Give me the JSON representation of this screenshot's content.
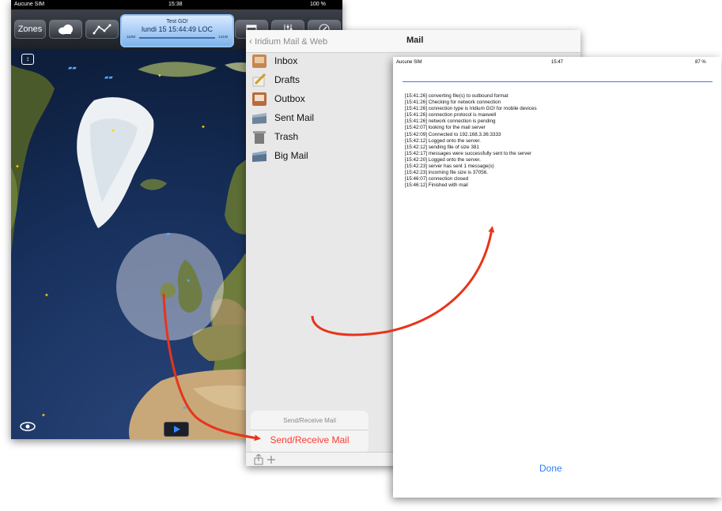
{
  "map_app": {
    "status_bar": {
      "carrier": "Aucune SIM",
      "time": "15:38",
      "battery": "100 %"
    },
    "toolbar": {
      "zones_label": "Zones",
      "center_title": "Test GO!",
      "center_time": "lundi 15 15:44:49 LOC",
      "scale_left": "110W",
      "scale_right": "141W"
    }
  },
  "mail_panel": {
    "back_label": "Iridium Mail & Web",
    "title": "Mail",
    "mailboxes": [
      {
        "label": "Inbox",
        "icon": "inbox-tray-icon"
      },
      {
        "label": "Drafts",
        "icon": "drafts-pencil-icon"
      },
      {
        "label": "Outbox",
        "icon": "outbox-tray-icon"
      },
      {
        "label": "Sent Mail",
        "icon": "sent-folder-icon"
      },
      {
        "label": "Trash",
        "icon": "trash-can-icon"
      },
      {
        "label": "Big Mail",
        "icon": "big-mail-folder-icon"
      }
    ],
    "action_sheet": {
      "title": "Send/Receive Mail",
      "action": "Send/Receive Mail"
    }
  },
  "log_window": {
    "status_bar": {
      "carrier": "Aucune SIM",
      "time": "15:47",
      "battery": "87 %"
    },
    "lines": [
      "[15:41:26] converting file(s) to outbound format",
      "[15:41:26] Checking for network connection",
      "[15:41:26] connection type is Iridium GO! for mobile devices",
      "[15:41:26] connection protocol is maxwell",
      "[15:41:26] network connection is pending",
      "[15:42:07] looking for the mail server",
      "[15:42:09] Connected to 192.168.3.36:3333",
      "[15:42:12] Logged onto the server.",
      "[15:42:12] sending file of size 381",
      "[15:42:17] messages were successfully sent to the server",
      "[15:42:20] Logged onto the server.",
      "[15:42:23] server has sent 1 message(s)",
      "[15:42:23] incoming file size is 37056.",
      "[15:46:07] connection closed",
      "[15:46:12] Finished with mail"
    ],
    "done_label": "Done"
  },
  "colors": {
    "accent_blue": "#2f7ff7",
    "destructive_red": "#ff3b30",
    "arrow_red": "#e8341c"
  }
}
